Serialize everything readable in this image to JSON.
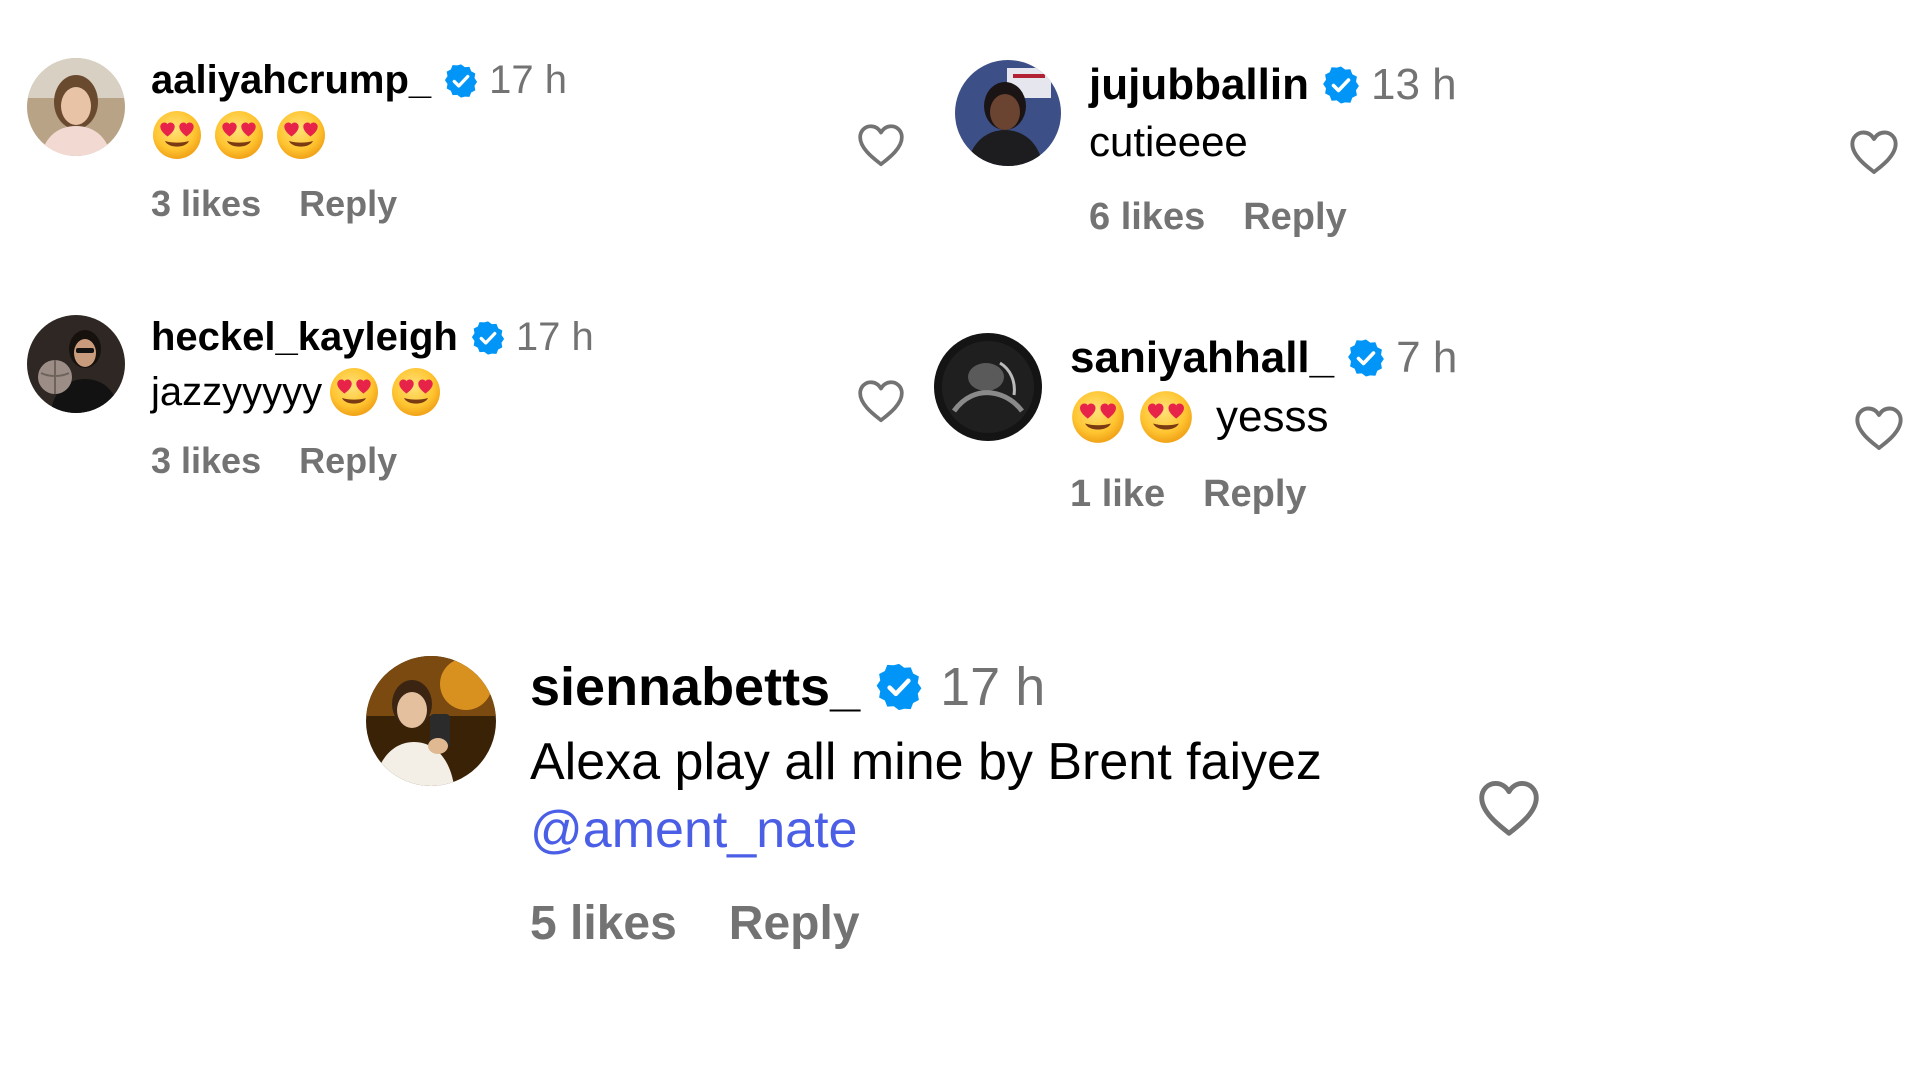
{
  "comments": [
    {
      "username": "aaliyahcrump_",
      "time": "17 h",
      "text": "",
      "emoji_count": 3,
      "likes": "3 likes",
      "reply": "Reply",
      "verified": true
    },
    {
      "username": "jujubballin",
      "time": "13 h",
      "text": "cutieeee",
      "likes": "6 likes",
      "reply": "Reply",
      "verified": true
    },
    {
      "username": "heckel_kayleigh",
      "time": "17 h",
      "text": "jazzyyyyy",
      "emoji_count": 2,
      "likes": "3 likes",
      "reply": "Reply",
      "verified": true
    },
    {
      "username": "saniyahhall_",
      "time": "7 h",
      "text": "yesss",
      "emoji_count": 2,
      "likes": "1 like",
      "reply": "Reply",
      "verified": true
    },
    {
      "username": "siennabetts_",
      "time": "17 h",
      "text": "Alexa play all mine by Brent faiyez",
      "mention": "@ament_nate",
      "likes": "5 likes",
      "reply": "Reply",
      "verified": true
    }
  ],
  "icons": {
    "verified": "verified-badge-icon",
    "heart": "heart-outline-icon",
    "emoji": "heart-eyes-emoji"
  },
  "colors": {
    "verified_blue": "#0095f6",
    "secondary_text": "#737373",
    "mention": "#4b5fe6",
    "heart_outline": "#737373"
  }
}
